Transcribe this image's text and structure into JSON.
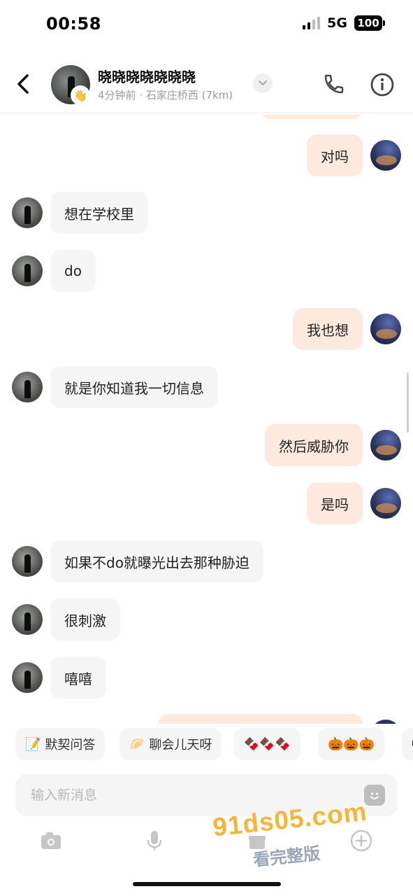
{
  "status_bar": {
    "time": "00:58",
    "network": "5G",
    "battery": "100"
  },
  "header": {
    "contact_name": "晓晓晓晓晓晓晓",
    "subtitle": "4分钟前 · 石家庄桥西 (7km)",
    "badge_emoji": "👋"
  },
  "messages": [
    {
      "side": "out",
      "text": "对吗"
    },
    {
      "side": "in",
      "text": "想在学校里"
    },
    {
      "side": "in",
      "text": "do"
    },
    {
      "side": "out",
      "text": "我也想"
    },
    {
      "side": "in",
      "text": "就是你知道我一切信息"
    },
    {
      "side": "out",
      "text": "然后威胁你"
    },
    {
      "side": "out",
      "text": "是吗"
    },
    {
      "side": "in",
      "text": "如果不do就曝光出去那种胁迫"
    },
    {
      "side": "in",
      "text": "很刺激"
    },
    {
      "side": "in",
      "text": "嘻嘻"
    }
  ],
  "quick_replies": [
    {
      "icon": "📝",
      "label": "默契问答"
    },
    {
      "icon": "🥟",
      "label": "聊会儿天呀"
    },
    {
      "icon": "🍫🍫🍫",
      "label": ""
    },
    {
      "icon": "🎃🎃🎃",
      "label": ""
    },
    {
      "icon": "💬",
      "label": ""
    }
  ],
  "input": {
    "placeholder": "输入新消息"
  },
  "watermark": {
    "main": "91ds05.com",
    "sub": "看完整版"
  },
  "colors": {
    "outgoing_bubble": "#fde9de",
    "incoming_bubble": "#f5f5f5",
    "watermark": "#f4b53a"
  }
}
